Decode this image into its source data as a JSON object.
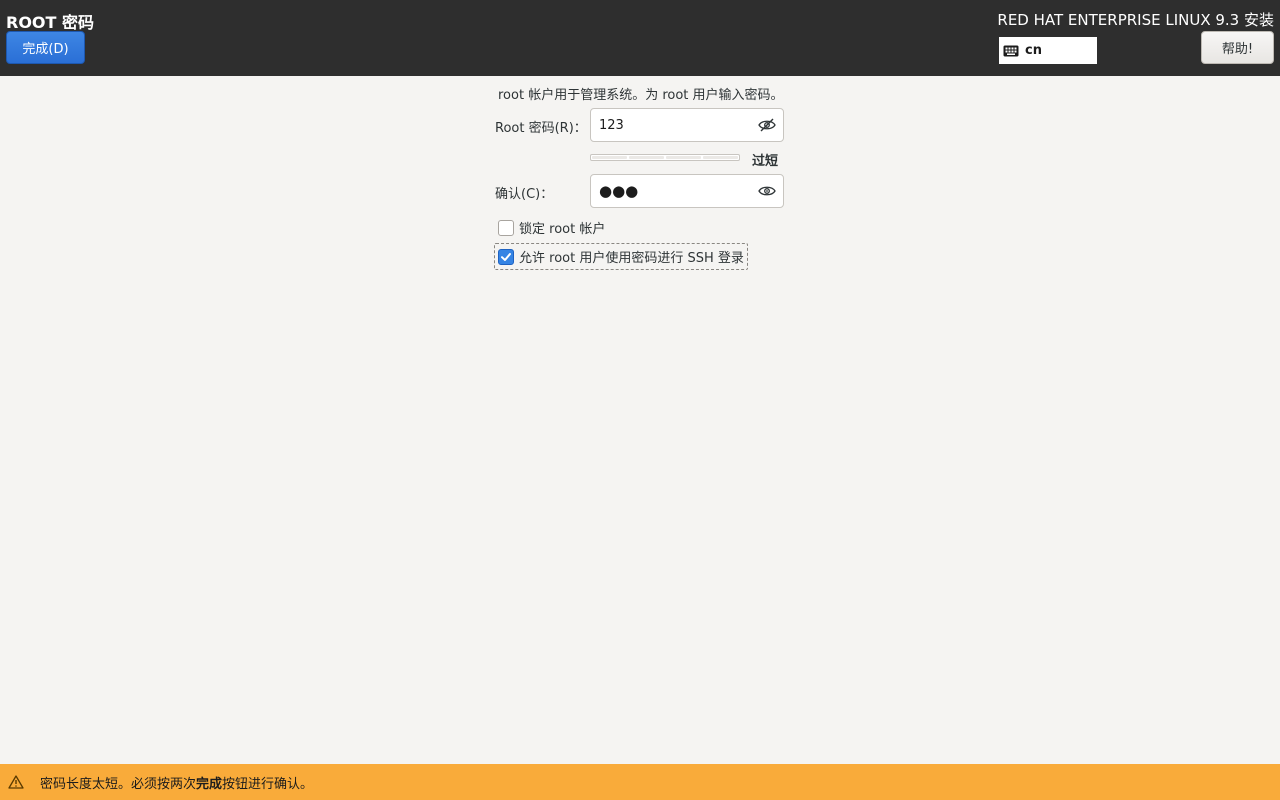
{
  "header": {
    "title": "ROOT 密码",
    "done_label": "完成(D)",
    "product": "RED HAT ENTERPRISE LINUX 9.3 安装",
    "keyboard_layout": "cn",
    "help_label": "帮助!"
  },
  "form": {
    "description": "root 帐户用于管理系统。为 root 用户输入密码。",
    "password_label": "Root 密码(R)：",
    "password_value": "123",
    "password_visible": true,
    "strength_level": 0,
    "strength_label": "过短",
    "confirm_label": "确认(C)：",
    "confirm_value": "●●●",
    "confirm_visible": false,
    "lock_root_label": "锁定 root 帐户",
    "lock_root_checked": false,
    "allow_ssh_label": "允许 root 用户使用密码进行 SSH 登录",
    "allow_ssh_checked": true
  },
  "warning": {
    "prefix": "密码长度太短。必须按两次",
    "emphasis": "完成",
    "suffix": "按钮进行确认。"
  },
  "colors": {
    "header_bg": "#2e2e2e",
    "accent": "#3584e4",
    "warning_bg": "#f9ab3a",
    "page_bg": "#f5f4f2"
  },
  "icons": {
    "keyboard": "keyboard-icon",
    "password_toggle": "eye-hidden-icon",
    "confirm_toggle": "eye-icon",
    "warning": "warning-triangle-icon",
    "check": "checkmark-icon"
  }
}
